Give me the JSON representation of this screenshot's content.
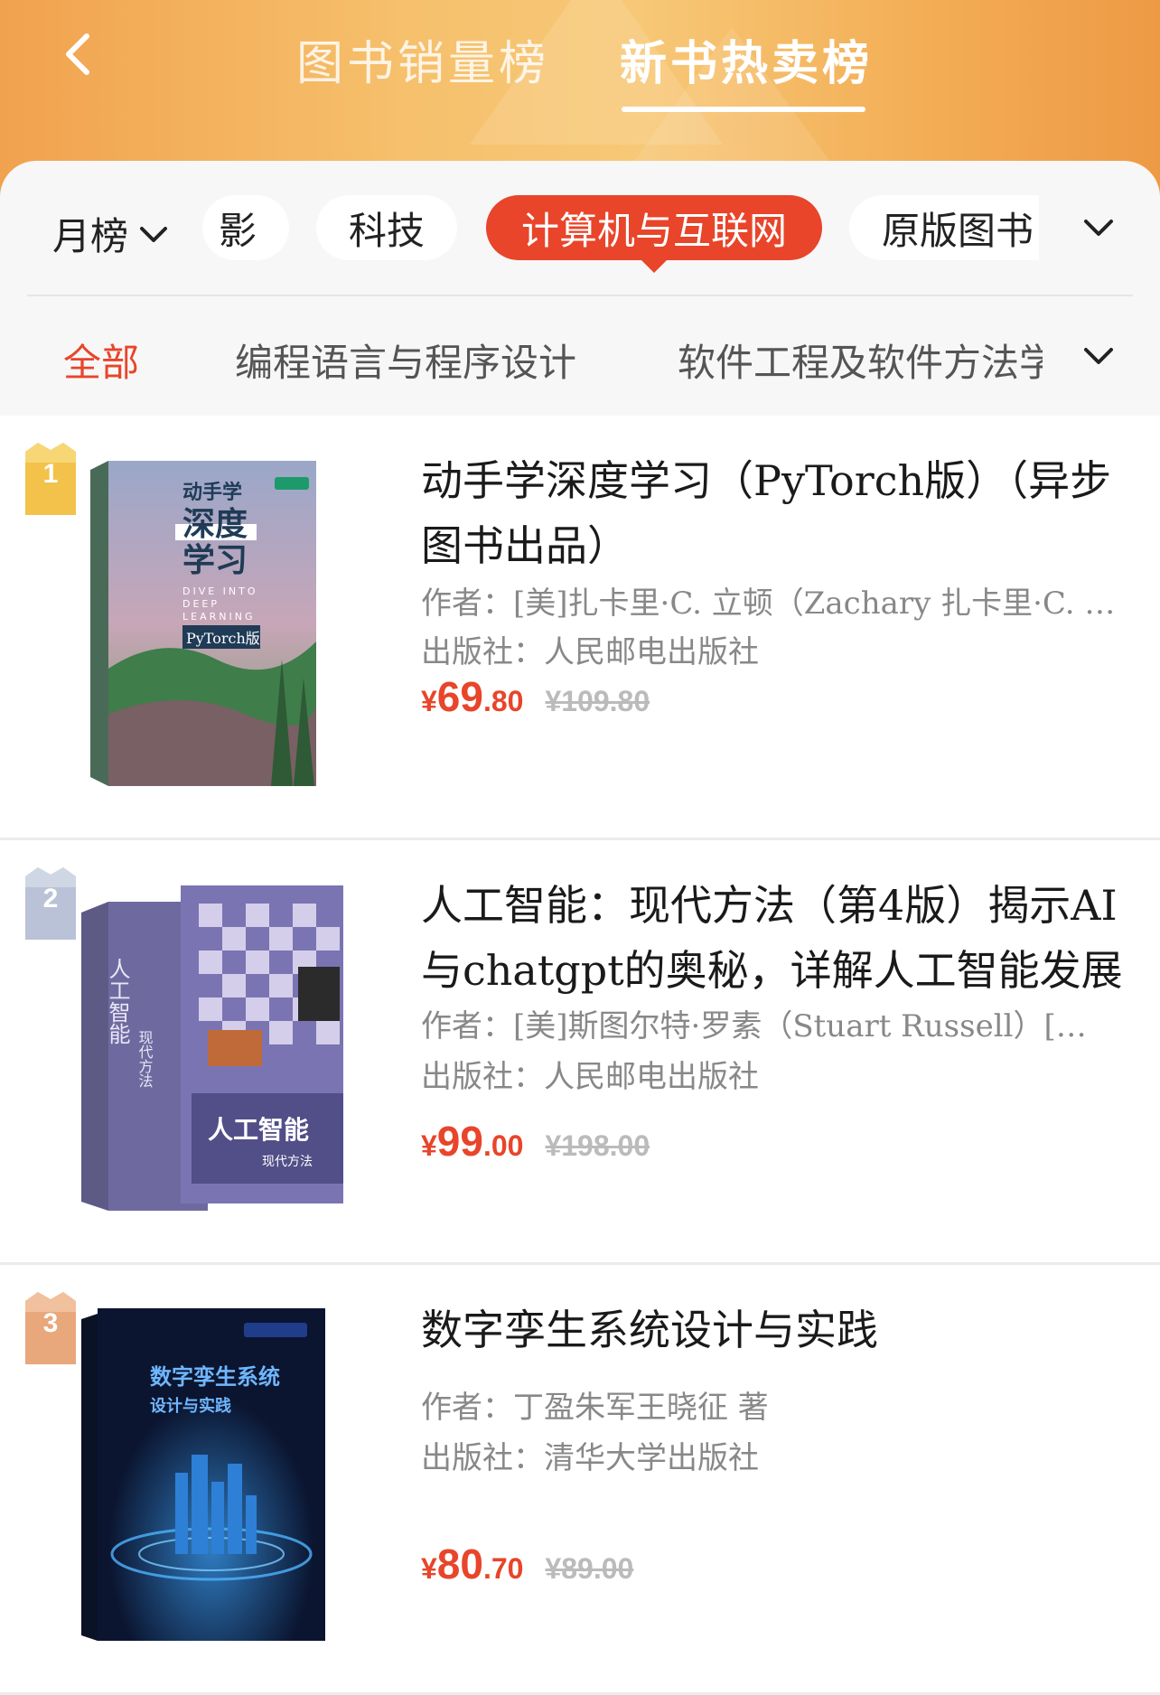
{
  "header": {
    "tabs": [
      {
        "label": "图书销量榜",
        "active": false
      },
      {
        "label": "新书热卖榜",
        "active": true
      }
    ],
    "back_icon": "chevron-left-icon"
  },
  "filters": {
    "period": "月榜",
    "chips": [
      "影",
      "科技",
      "计算机与互联网",
      "原版图书"
    ],
    "active_chip": "计算机与互联网",
    "subcategories": [
      "全部",
      "编程语言与程序设计",
      "软件工程及软件方法学"
    ],
    "active_subcategory": "全部"
  },
  "colors": {
    "accent": "#e8452a",
    "header_start": "#f1a24e",
    "gold": "#f3c24a",
    "silver": "#b9c2d6",
    "bronze": "#e9a77c"
  },
  "books": [
    {
      "rank": "1",
      "title": "动手学深度学习（PyTorch版）（异步图书出品）",
      "author": "作者：[美]扎卡里·C. 立顿（Zachary 扎卡里·C. 立顿）",
      "publisher": "出版社：人民邮电出版社",
      "price_symbol": "¥",
      "price_int": "69",
      "price_dec": ".80",
      "original_price": "¥109.80",
      "cover_text": [
        "动手学",
        "深度",
        "学习",
        "DIVE INTO",
        "DEEP",
        "LEARNING",
        "PyTorch版"
      ]
    },
    {
      "rank": "2",
      "title": "人工智能：现代方法（第4版）揭示AI与chatgpt的奥秘，详解人工智能发展",
      "author": "作者：[美]斯图尔特·罗素（Stuart Russell）[美]彼得·诺维格",
      "publisher": "出版社：人民邮电出版社",
      "price_symbol": "¥",
      "price_int": "99",
      "price_dec": ".00",
      "original_price": "¥198.00",
      "cover_text": [
        "人工智能",
        "现代方法"
      ]
    },
    {
      "rank": "3",
      "title": "数字孪生系统设计与实践",
      "author": "作者：丁盈朱军王晓征 著",
      "publisher": "出版社：清华大学出版社",
      "price_symbol": "¥",
      "price_int": "80",
      "price_dec": ".70",
      "original_price": "¥89.00",
      "cover_text": [
        "数字孪生系统",
        "设计与实践"
      ]
    }
  ]
}
